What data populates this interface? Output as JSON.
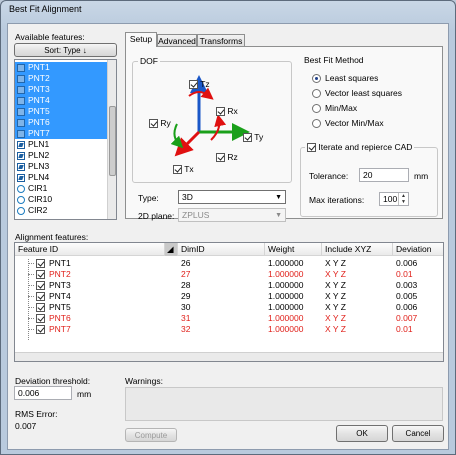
{
  "window": {
    "title": "Best Fit Alignment"
  },
  "available": {
    "label": "Available features:",
    "sort_button": "Sort: Type ↓",
    "items": [
      {
        "name": "PNT1",
        "type": "pnt",
        "selected": true
      },
      {
        "name": "PNT2",
        "type": "pnt",
        "selected": true
      },
      {
        "name": "PNT3",
        "type": "pnt",
        "selected": true
      },
      {
        "name": "PNT4",
        "type": "pnt",
        "selected": true
      },
      {
        "name": "PNT5",
        "type": "pnt",
        "selected": true
      },
      {
        "name": "PNT6",
        "type": "pnt",
        "selected": true
      },
      {
        "name": "PNT7",
        "type": "pnt",
        "selected": true
      },
      {
        "name": "PLN1",
        "type": "pln",
        "selected": false
      },
      {
        "name": "PLN2",
        "type": "pln",
        "selected": false
      },
      {
        "name": "PLN3",
        "type": "pln",
        "selected": false
      },
      {
        "name": "PLN4",
        "type": "pln",
        "selected": false
      },
      {
        "name": "CIR1",
        "type": "cir",
        "selected": false
      },
      {
        "name": "CIR10",
        "type": "cir",
        "selected": false
      },
      {
        "name": "CIR2",
        "type": "cir",
        "selected": false
      }
    ]
  },
  "tabs": [
    {
      "label": "Setup",
      "active": true
    },
    {
      "label": "Advanced",
      "active": false
    },
    {
      "label": "Transforms",
      "active": false
    }
  ],
  "dof": {
    "title": "DOF",
    "axes": {
      "tz": "Tz",
      "rx": "Rx",
      "ry": "Ry",
      "ty": "Ty",
      "rz": "Rz",
      "tx": "Tx"
    },
    "type_label": "Type:",
    "type_value": "3D",
    "plane_label": "2D plane:",
    "plane_value": "ZPLUS"
  },
  "method": {
    "title": "Best Fit Method",
    "options": [
      {
        "label": "Least squares",
        "selected": true
      },
      {
        "label": "Vector least squares",
        "selected": false
      },
      {
        "label": "Min/Max",
        "selected": false
      },
      {
        "label": "Vector Min/Max",
        "selected": false
      }
    ]
  },
  "iterate": {
    "label": "Iterate and repierce CAD",
    "tolerance_label": "Tolerance:",
    "tolerance_value": "20",
    "tolerance_unit": "mm",
    "maxiter_label": "Max iterations:",
    "maxiter_value": "100"
  },
  "alignment": {
    "label": "Alignment features:",
    "columns": [
      "Feature ID",
      "DimID",
      "Weight",
      "Include XYZ",
      "Deviation"
    ],
    "rows": [
      {
        "id": "PNT1",
        "dim": "26",
        "weight": "1.000000",
        "xyz": "X Y Z",
        "dev": "0.006",
        "red": false
      },
      {
        "id": "PNT2",
        "dim": "27",
        "weight": "1.000000",
        "xyz": "X Y Z",
        "dev": "0.01",
        "red": true
      },
      {
        "id": "PNT3",
        "dim": "28",
        "weight": "1.000000",
        "xyz": "X Y Z",
        "dev": "0.003",
        "red": false
      },
      {
        "id": "PNT4",
        "dim": "29",
        "weight": "1.000000",
        "xyz": "X Y Z",
        "dev": "0.005",
        "red": false
      },
      {
        "id": "PNT5",
        "dim": "30",
        "weight": "1.000000",
        "xyz": "X Y Z",
        "dev": "0.006",
        "red": false
      },
      {
        "id": "PNT6",
        "dim": "31",
        "weight": "1.000000",
        "xyz": "X Y Z",
        "dev": "0.007",
        "red": true
      },
      {
        "id": "PNT7",
        "dim": "32",
        "weight": "1.000000",
        "xyz": "X Y Z",
        "dev": "0.01",
        "red": true
      }
    ]
  },
  "bottom": {
    "threshold_label": "Deviation threshold:",
    "threshold_value": "0.006",
    "threshold_unit": "mm",
    "rms_label": "RMS Error:",
    "rms_value": "0.007",
    "warnings_label": "Warnings:",
    "compute": "Compute",
    "ok": "OK",
    "cancel": "Cancel"
  },
  "colors": {
    "selection": "#3399ff",
    "out_of_tolerance": "#e0201a"
  }
}
